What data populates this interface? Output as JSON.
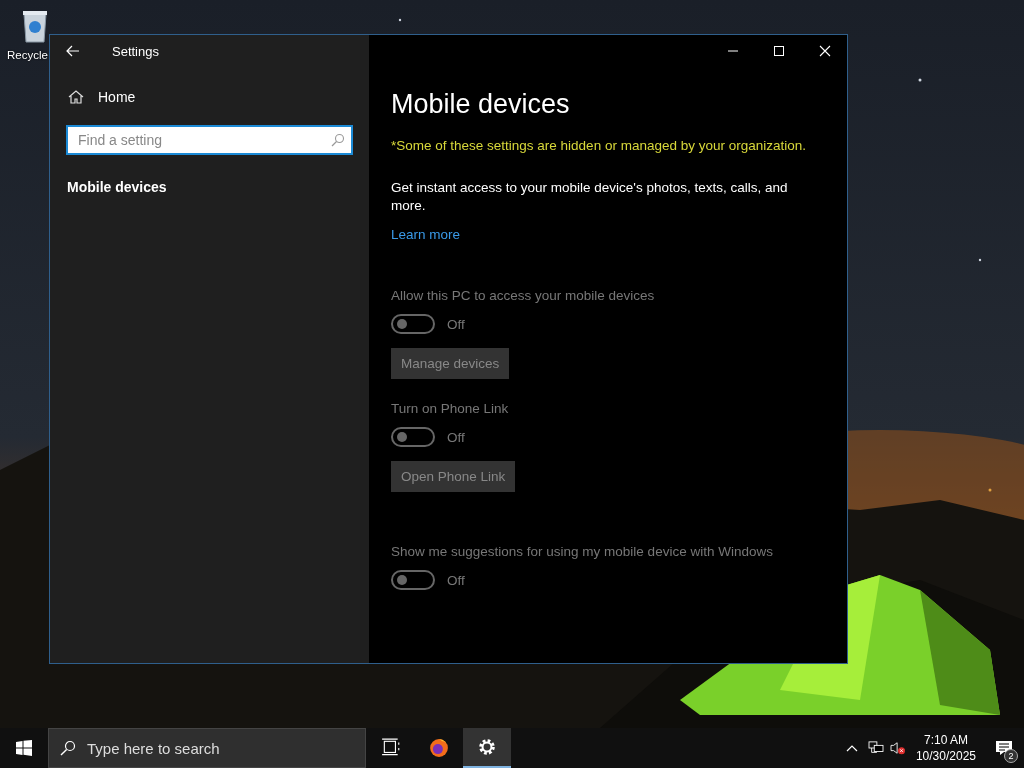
{
  "desktop": {
    "icons": [
      {
        "label": "Recycle"
      }
    ]
  },
  "window": {
    "title": "Settings",
    "sidebar": {
      "home": "Home",
      "search": {
        "placeholder": "Find a setting"
      },
      "items": [
        {
          "label": "Mobile devices",
          "selected": true
        }
      ]
    },
    "content": {
      "heading": "Mobile devices",
      "notice": "*Some of these settings are hidden or managed by your organization.",
      "description": "Get instant access to your mobile device's photos, texts, calls, and more.",
      "link": "Learn more",
      "settings": [
        {
          "kind": "toggle",
          "label": "Allow this PC to access your mobile devices",
          "on": false,
          "state_text": "Off",
          "disabled": true
        },
        {
          "kind": "button",
          "label": "Manage devices",
          "disabled": true
        },
        {
          "kind": "toggle",
          "label": "Turn on Phone Link",
          "on": false,
          "state_text": "Off",
          "disabled": true
        },
        {
          "kind": "button",
          "label": "Open Phone Link",
          "disabled": true
        },
        {
          "kind": "toggle",
          "label": "Show me suggestions for using my mobile device with Windows",
          "on": false,
          "state_text": "Off",
          "disabled": true
        }
      ]
    }
  },
  "taskbar": {
    "search": {
      "placeholder": "Type here to search"
    },
    "apps": [
      {
        "kind": "task-view",
        "selected": false
      },
      {
        "kind": "firefox",
        "selected": false
      },
      {
        "kind": "settings",
        "selected": true
      }
    ],
    "time": "7:10 AM",
    "date": "10/30/2025",
    "notifications": "2"
  }
}
